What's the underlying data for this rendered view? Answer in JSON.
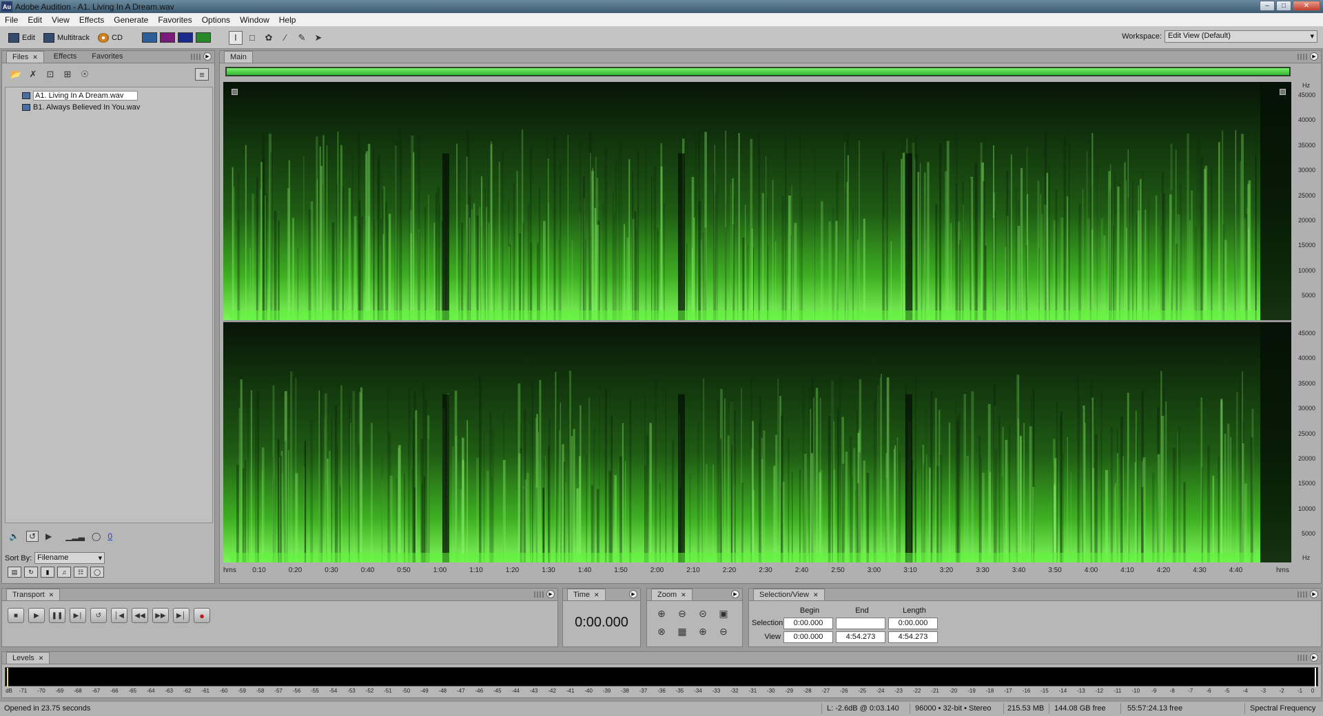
{
  "window": {
    "app_icon": "Au",
    "title": "Adobe Audition - A1. Living In A Dream.wav"
  },
  "menu": [
    "File",
    "Edit",
    "View",
    "Effects",
    "Generate",
    "Favorites",
    "Options",
    "Window",
    "Help"
  ],
  "toolbar": {
    "edit_label": "Edit",
    "multitrack_label": "Multitrack",
    "cd_label": "CD",
    "view_modes": [
      {
        "name": "waveform-view-icon",
        "color": "#2c5e9a"
      },
      {
        "name": "spectral-frequency-view-icon",
        "color": "#7a1a7a"
      },
      {
        "name": "spectral-pan-view-icon",
        "color": "#1a2a8a"
      },
      {
        "name": "spectral-phase-view-icon",
        "color": "#2a8a2a"
      }
    ],
    "workspace_label": "Workspace:",
    "workspace_value": "Edit View (Default)"
  },
  "files_panel": {
    "tabs": [
      "Files",
      "Effects",
      "Favorites"
    ],
    "files": [
      "A1. Living In A Dream.wav",
      "B1. Always Believed In You.wav"
    ],
    "volume_value": "0",
    "sort_by_label": "Sort By:",
    "sort_by_value": "Filename"
  },
  "main_panel": {
    "tab": "Main",
    "hz_unit": "Hz",
    "hz_labels": [
      "45000",
      "40000",
      "35000",
      "30000",
      "25000",
      "20000",
      "15000",
      "10000",
      "5000"
    ],
    "time_unit": "hms",
    "time_labels": [
      "0:10",
      "0:20",
      "0:30",
      "0:40",
      "0:50",
      "1:00",
      "1:10",
      "1:20",
      "1:30",
      "1:40",
      "1:50",
      "2:00",
      "2:10",
      "2:20",
      "2:30",
      "2:40",
      "2:50",
      "3:00",
      "3:10",
      "3:20",
      "3:30",
      "3:40",
      "3:50",
      "4:00",
      "4:10",
      "4:20",
      "4:30",
      "4:40"
    ],
    "spectrogram_color": "#5ff23a"
  },
  "transport": {
    "title": "Transport"
  },
  "time_panel": {
    "title": "Time",
    "value": "0:00.000"
  },
  "zoom_panel": {
    "title": "Zoom"
  },
  "selection_view": {
    "title": "Selection/View",
    "begin_label": "Begin",
    "end_label": "End",
    "length_label": "Length",
    "selection_label": "Selection",
    "view_label": "View",
    "selection": {
      "begin": "0:00.000",
      "end": "",
      "length": "0:00.000"
    },
    "view": {
      "begin": "0:00.000",
      "end": "4:54.273",
      "length": "4:54.273"
    }
  },
  "levels": {
    "title": "Levels",
    "scale": [
      "dB",
      "-71",
      "-70",
      "-69",
      "-68",
      "-67",
      "-66",
      "-65",
      "-64",
      "-63",
      "-62",
      "-61",
      "-60",
      "-59",
      "-58",
      "-57",
      "-56",
      "-55",
      "-54",
      "-53",
      "-52",
      "-51",
      "-50",
      "-49",
      "-48",
      "-47",
      "-46",
      "-45",
      "-44",
      "-43",
      "-42",
      "-41",
      "-40",
      "-39",
      "-38",
      "-37",
      "-36",
      "-35",
      "-34",
      "-33",
      "-32",
      "-31",
      "-30",
      "-29",
      "-28",
      "-27",
      "-26",
      "-25",
      "-24",
      "-23",
      "-22",
      "-21",
      "-20",
      "-19",
      "-18",
      "-17",
      "-16",
      "-15",
      "-14",
      "-13",
      "-12",
      "-11",
      "-10",
      "-9",
      "-8",
      "-7",
      "-6",
      "-5",
      "-4",
      "-3",
      "-2",
      "-1",
      "0"
    ]
  },
  "status": {
    "opened": "Opened in 23.75 seconds",
    "cursor": "L: -2.6dB @  0:03.140",
    "format": "96000 • 32-bit • Stereo",
    "file_size": "215.53 MB",
    "disk_free": "144.08 GB free",
    "time_free": "55:57:24.13 free",
    "view_mode": "Spectral Frequency"
  }
}
